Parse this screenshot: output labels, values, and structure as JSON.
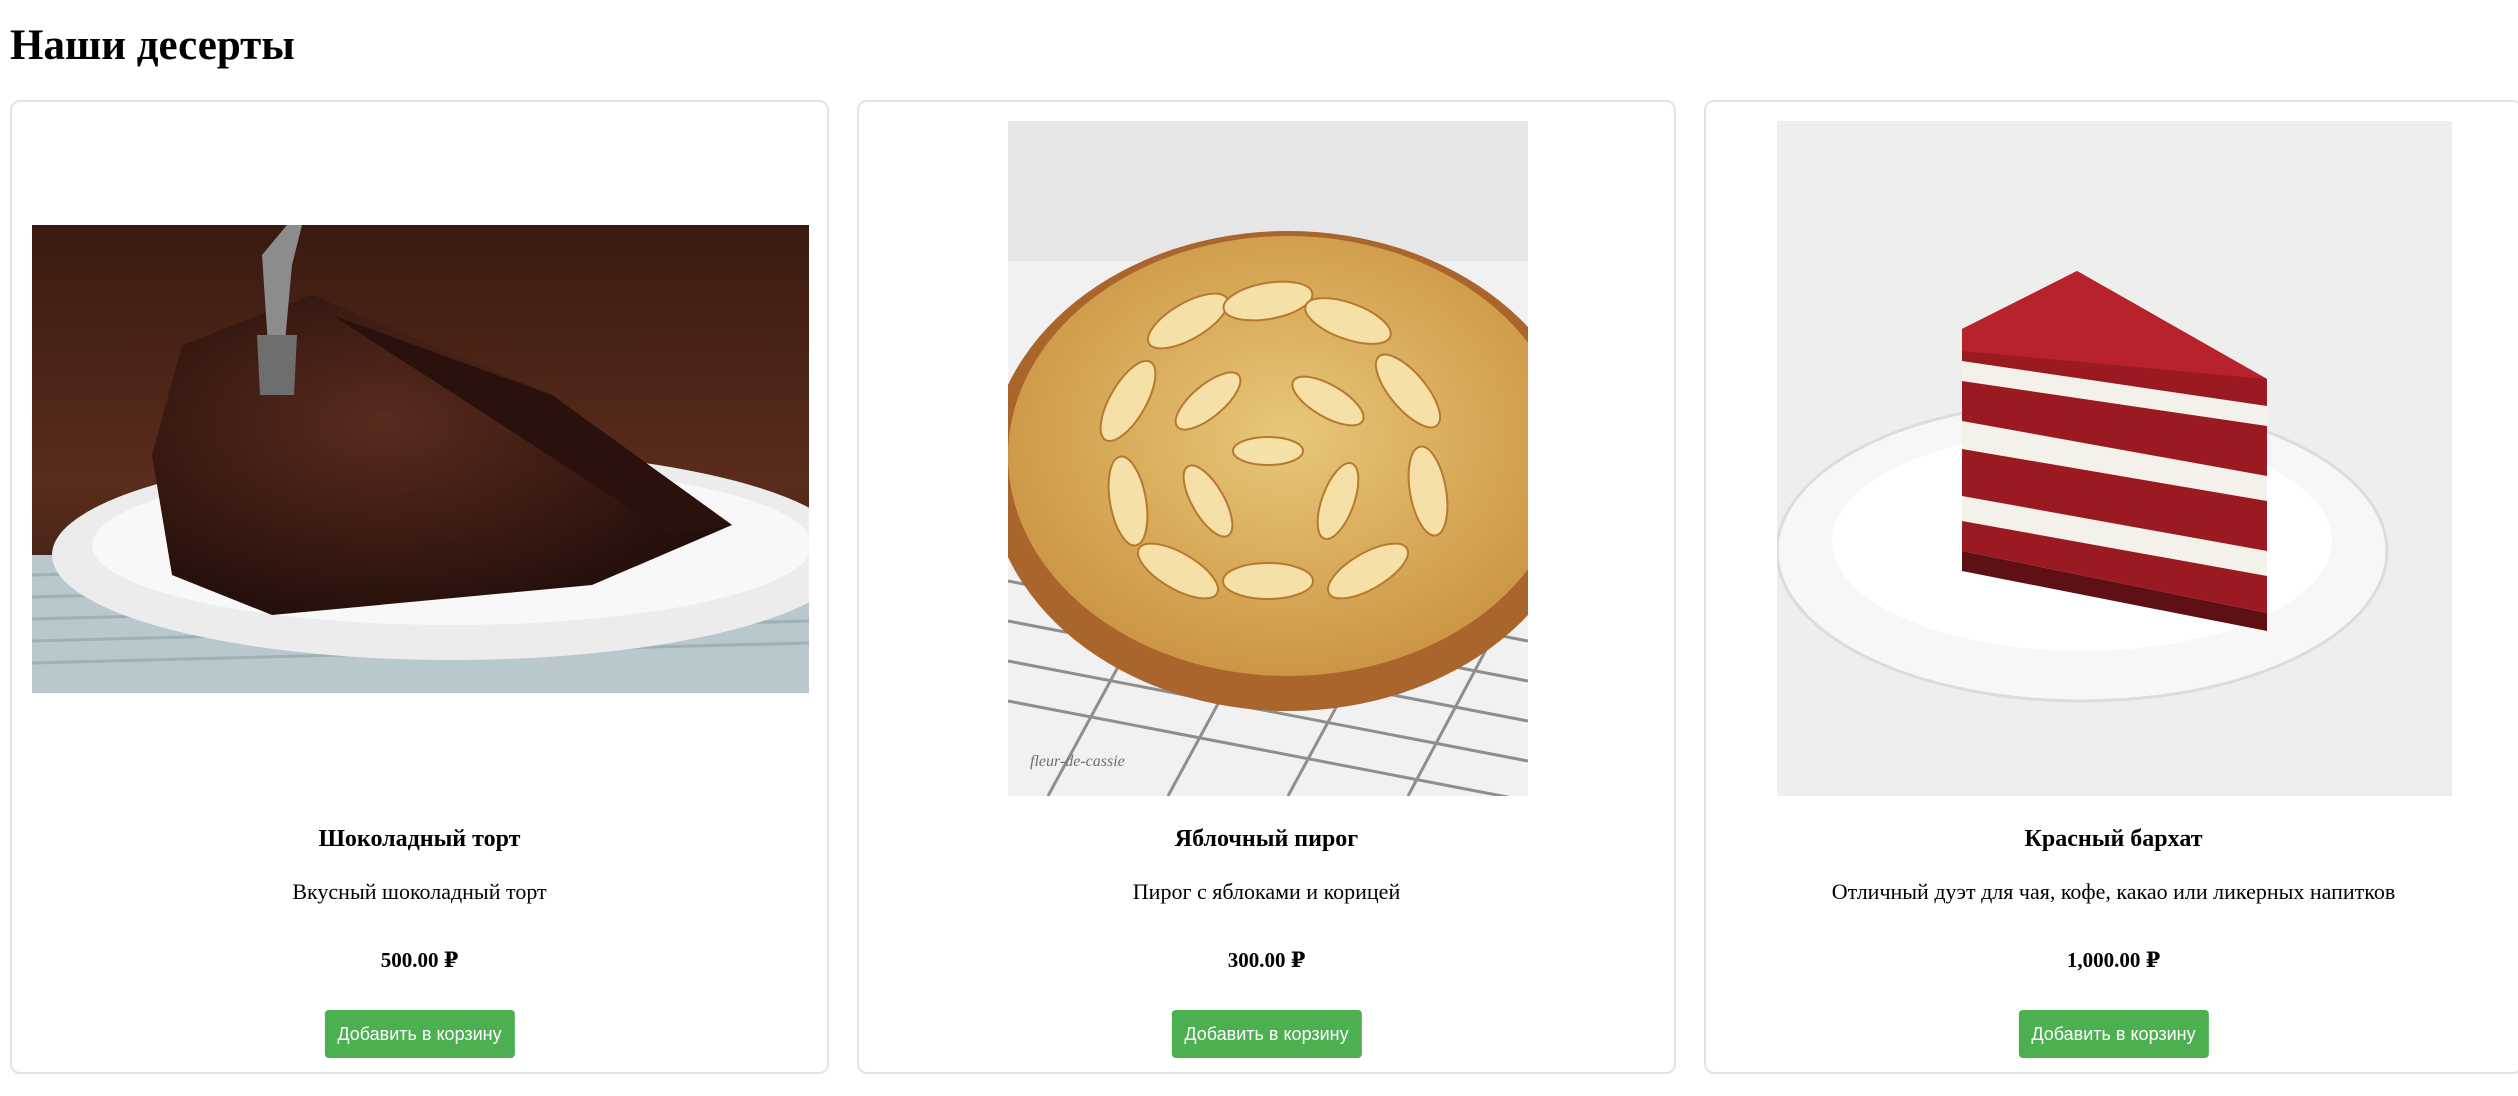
{
  "page": {
    "title": "Наши десерты"
  },
  "products": [
    {
      "name": "Шоколадный торт",
      "description": "Вкусный шоколадный торт",
      "price": "500.00 ₽",
      "button_label": "Добавить в корзину",
      "image": "chocolate-cake-photo"
    },
    {
      "name": "Яблочный пирог",
      "description": "Пирог с яблоками и корицей",
      "price": "300.00 ₽",
      "button_label": "Добавить в корзину",
      "image": "apple-pie-photo",
      "image_watermark": "fleur-de-cassie"
    },
    {
      "name": "Красный бархат",
      "description": "Отличный дуэт для чая, кофе, какао или ликерных напитков",
      "price": "1,000.00 ₽",
      "button_label": "Добавить в корзину",
      "image": "red-velvet-cake-photo"
    }
  ],
  "colors": {
    "button_background": "#4caf50",
    "button_text": "#ffffff",
    "card_border": "#e3e3e3"
  }
}
